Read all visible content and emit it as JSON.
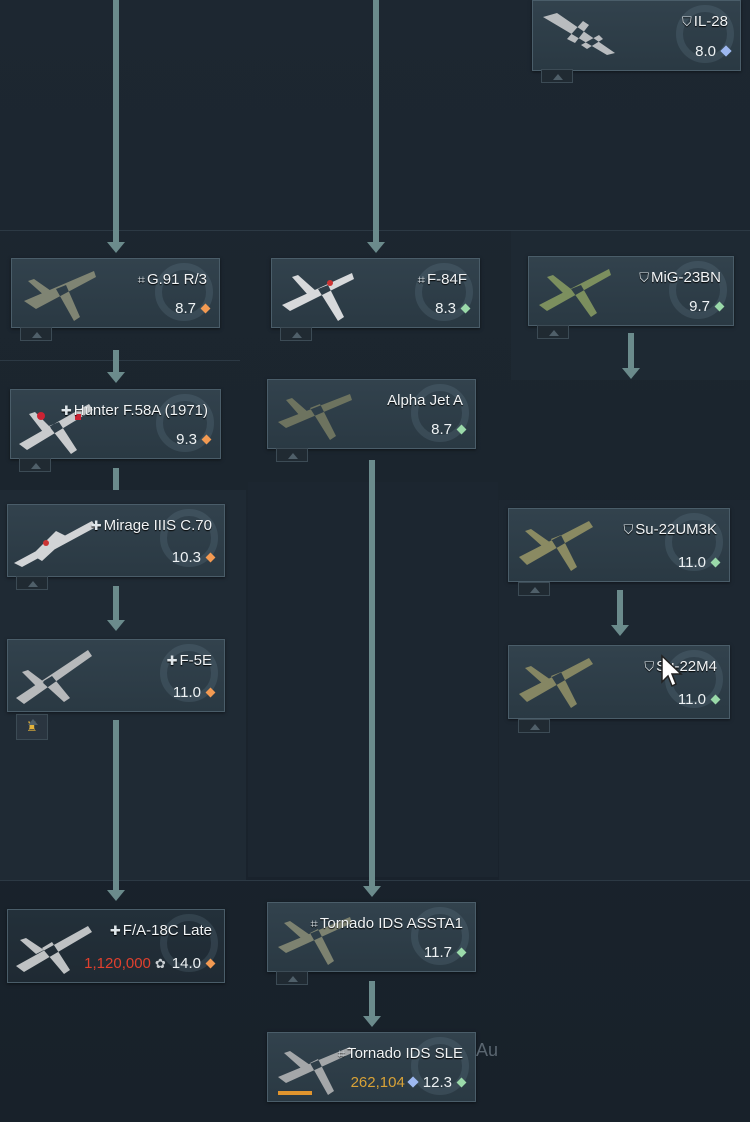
{
  "colors": {
    "accent_arrow": "#6b8b8c",
    "orange": "#f39a52",
    "green": "#9ad9a9",
    "blue": "#9db8f0",
    "cost_red": "#e0402e",
    "cost_gold": "#d9a237"
  },
  "cards": {
    "il28": {
      "nation_icon": "ussr-icon",
      "name": "IL-28",
      "br": "8.0"
    },
    "g91": {
      "nation_icon": "germany-icon",
      "name": "G.91 R/3",
      "br": "8.7"
    },
    "f84f": {
      "nation_icon": "germany-icon",
      "name": "F-84F",
      "br": "8.3"
    },
    "mig23bn": {
      "nation_icon": "ussr-icon",
      "name": "MiG-23BN",
      "br": "9.7"
    },
    "hunter": {
      "nation_icon": "switzerland-icon",
      "name": "Hunter F.58A (1971)",
      "br": "9.3"
    },
    "alphajet": {
      "nation_icon": "",
      "name": "Alpha Jet A",
      "br": "8.7"
    },
    "mirage": {
      "nation_icon": "switzerland-icon",
      "name": "Mirage IIIS C.70",
      "br": "10.3"
    },
    "su22um3k": {
      "nation_icon": "ussr-icon",
      "name": "Su-22UM3K",
      "br": "11.0"
    },
    "f5e": {
      "nation_icon": "switzerland-icon",
      "name": "F-5E",
      "br": "11.0"
    },
    "su22m4": {
      "nation_icon": "ussr-icon",
      "name": "Su-22M4",
      "br": "11.0"
    },
    "fa18c": {
      "nation_icon": "switzerland-icon",
      "name": "F/A-18C Late",
      "cost": "1,120,000",
      "br": "14.0"
    },
    "tornado_assta1": {
      "nation_icon": "germany-icon",
      "name": "Tornado IDS ASSTA1",
      "br": "11.7"
    },
    "tornado_sle": {
      "nation_icon": "germany-icon",
      "name": "Tornado IDS SLE",
      "cost": "262,104",
      "br": "12.3",
      "research_progress": 0.18
    }
  },
  "ghost_text": "Au"
}
